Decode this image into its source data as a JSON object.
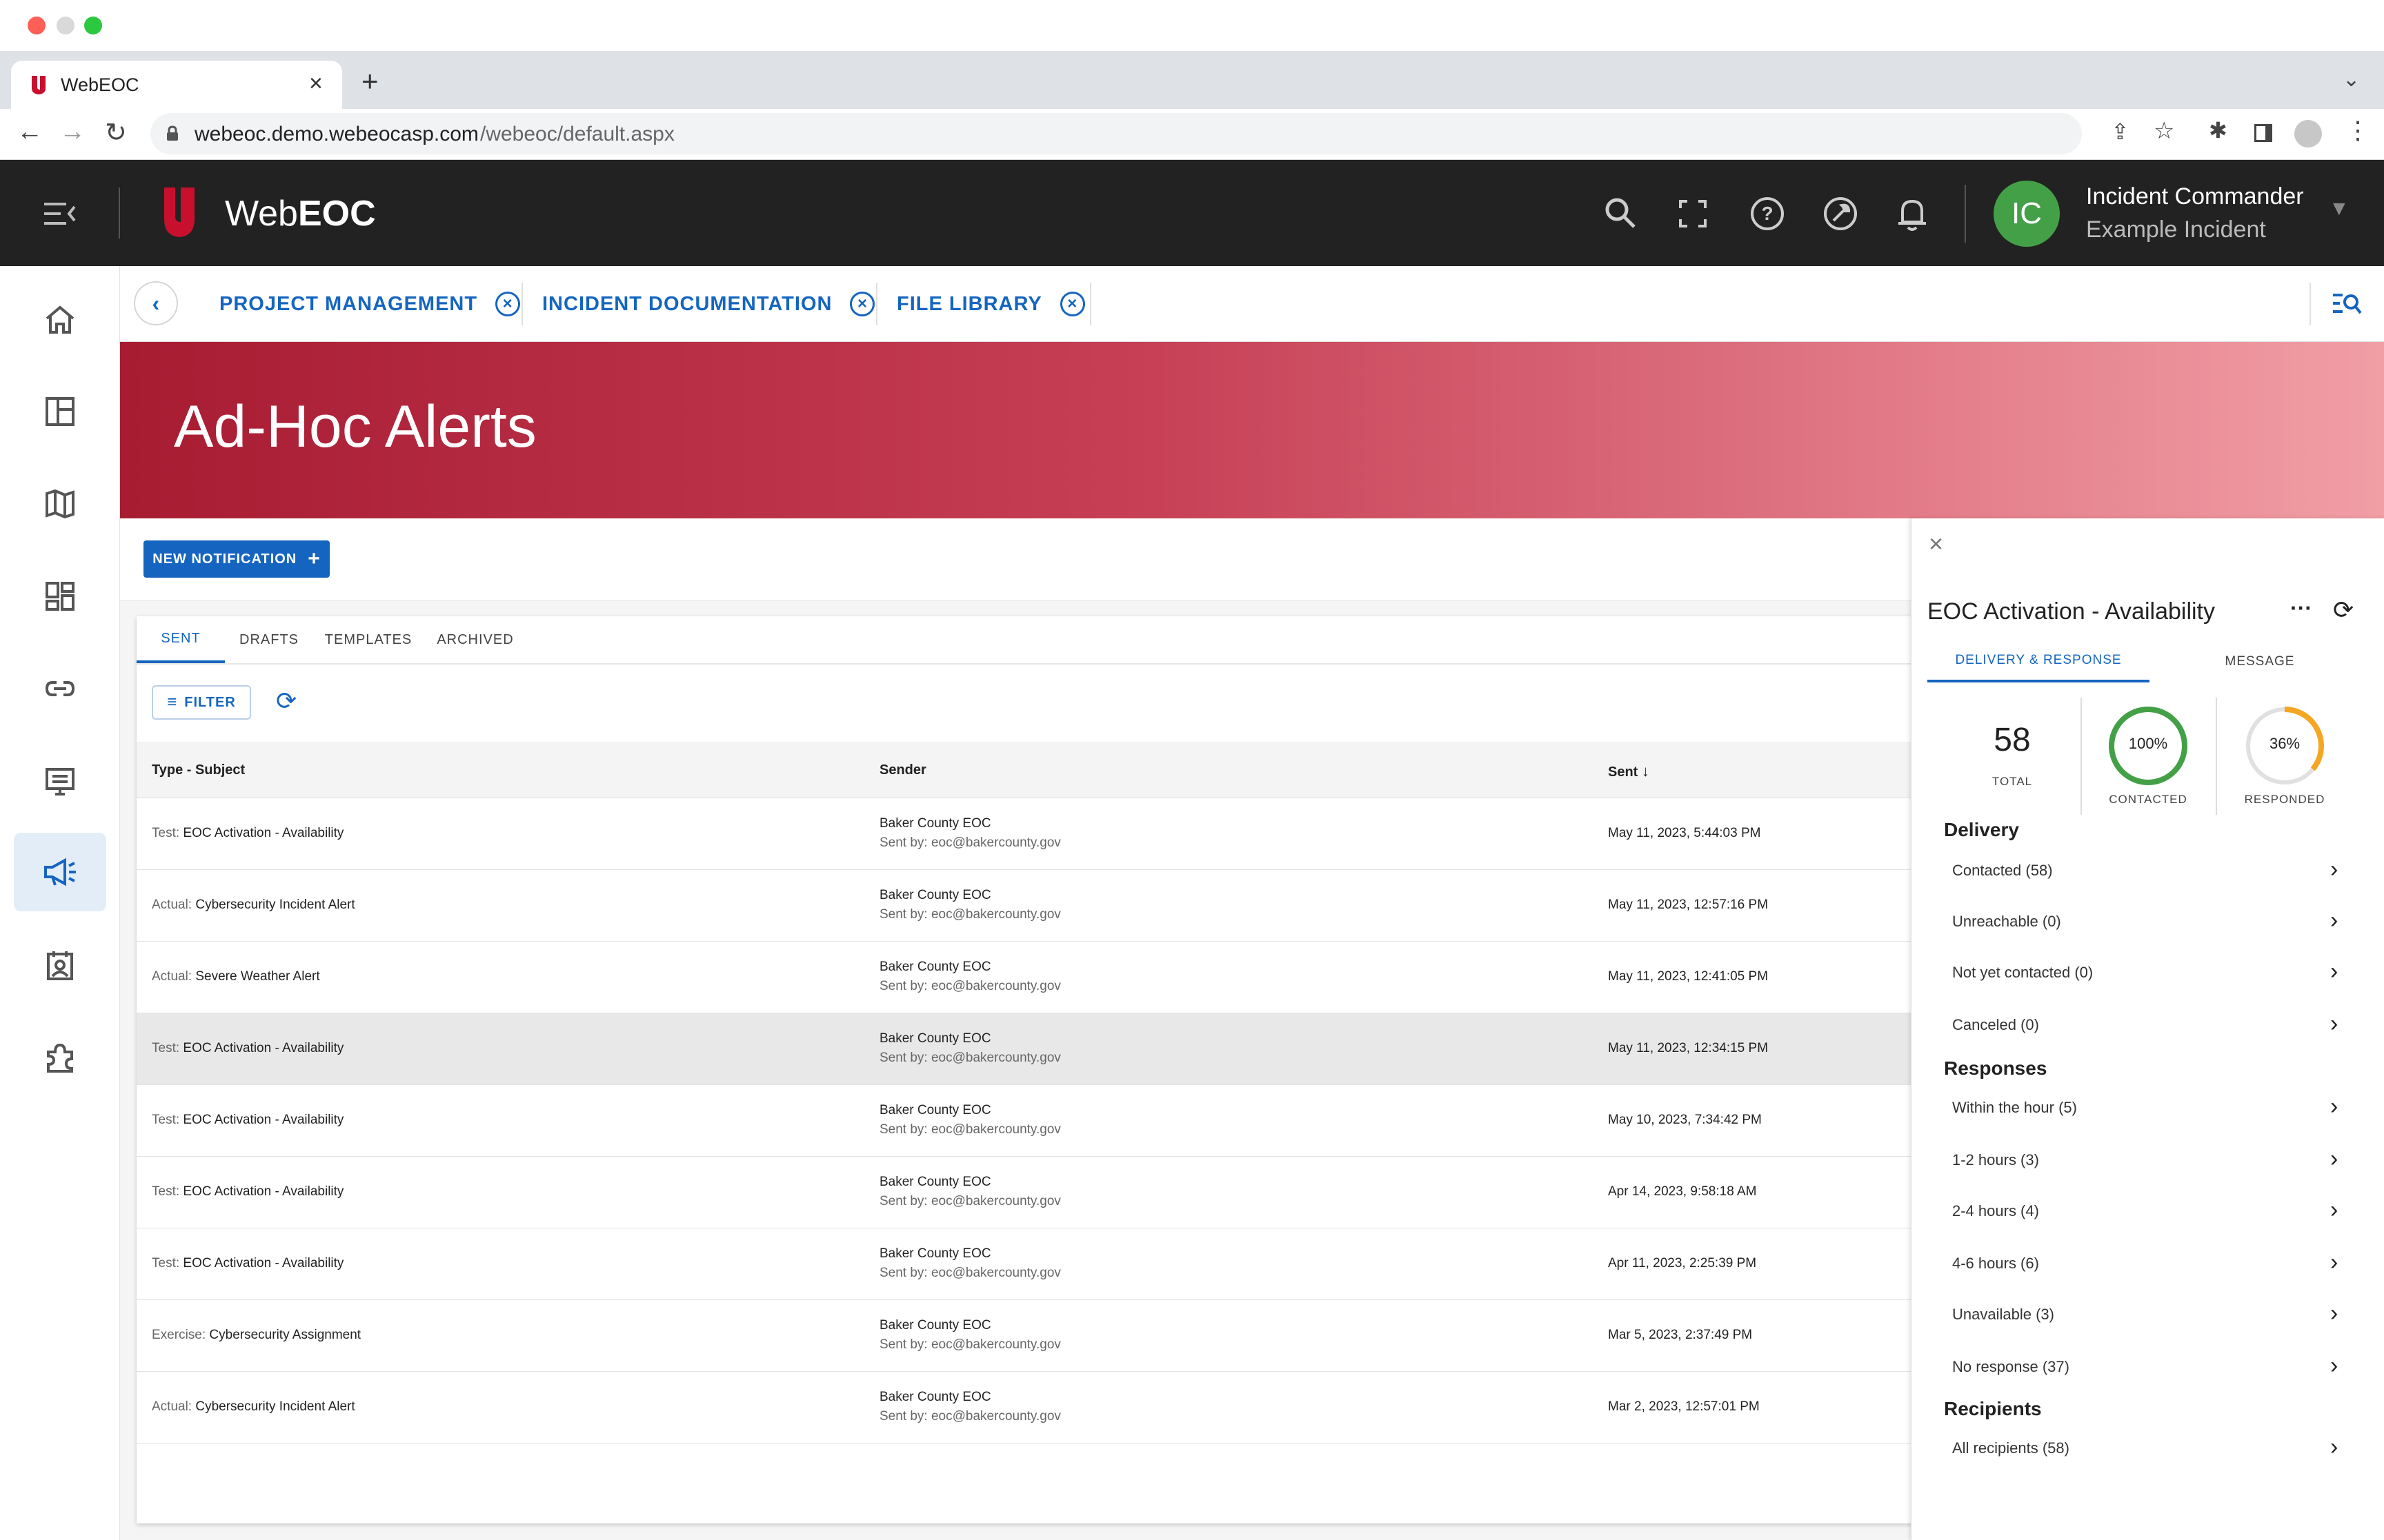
{
  "browser": {
    "tab_title": "WebEOC",
    "url_host": "webeoc.demo.webeocasp.com",
    "url_path": "/webeoc/default.aspx"
  },
  "app": {
    "brand_light": "Web",
    "brand_bold": "EOC",
    "user_initials": "IC",
    "user_role": "Incident Commander",
    "incident": "Example Incident",
    "accent": "#1565c0",
    "avatar_color": "#43a047"
  },
  "workspace_tabs": [
    {
      "label": "PROJECT MANAGEMENT"
    },
    {
      "label": "INCIDENT DOCUMENTATION"
    },
    {
      "label": "FILE LIBRARY"
    }
  ],
  "sidebar": {
    "items": [
      {
        "icon": "home-icon"
      },
      {
        "icon": "dashboard-layout-icon"
      },
      {
        "icon": "map-icon"
      },
      {
        "icon": "widgets-icon"
      },
      {
        "icon": "link-icon"
      },
      {
        "icon": "board-icon"
      },
      {
        "icon": "megaphone-icon",
        "active": true
      },
      {
        "icon": "contacts-icon"
      },
      {
        "icon": "plugin-icon"
      }
    ]
  },
  "banner": {
    "title": "Ad-Hoc Alerts"
  },
  "toolbar": {
    "new_notification": "NEW NOTIFICATION",
    "new_plus": "+"
  },
  "alerts": {
    "tabs": [
      "SENT",
      "DRAFTS",
      "TEMPLATES",
      "ARCHIVED"
    ],
    "filter_label": "FILTER",
    "columns": [
      "Type - Subject",
      "Sender",
      "Sent"
    ],
    "rows": [
      {
        "type": "Test:",
        "subject": "EOC Activation - Availability",
        "sender": "Baker County EOC",
        "sent_by": "Sent by: eoc@bakercounty.gov",
        "sent": "May 11, 2023, 5:44:03 PM"
      },
      {
        "type": "Actual:",
        "subject": "Cybersecurity Incident Alert",
        "sender": "Baker County EOC",
        "sent_by": "Sent by: eoc@bakercounty.gov",
        "sent": "May 11, 2023, 12:57:16 PM"
      },
      {
        "type": "Actual:",
        "subject": "Severe Weather Alert",
        "sender": "Baker County EOC",
        "sent_by": "Sent by: eoc@bakercounty.gov",
        "sent": "May 11, 2023, 12:41:05 PM"
      },
      {
        "type": "Test:",
        "subject": "EOC Activation - Availability",
        "sender": "Baker County EOC",
        "sent_by": "Sent by: eoc@bakercounty.gov",
        "sent": "May 11, 2023, 12:34:15 PM",
        "highlighted": true
      },
      {
        "type": "Test:",
        "subject": "EOC Activation - Availability",
        "sender": "Baker County EOC",
        "sent_by": "Sent by: eoc@bakercounty.gov",
        "sent": "May 10, 2023, 7:34:42 PM"
      },
      {
        "type": "Test:",
        "subject": "EOC Activation - Availability",
        "sender": "Baker County EOC",
        "sent_by": "Sent by: eoc@bakercounty.gov",
        "sent": "Apr 14, 2023, 9:58:18 AM"
      },
      {
        "type": "Test:",
        "subject": "EOC Activation - Availability",
        "sender": "Baker County EOC",
        "sent_by": "Sent by: eoc@bakercounty.gov",
        "sent": "Apr 11, 2023, 2:25:39 PM"
      },
      {
        "type": "Exercise:",
        "subject": "Cybersecurity Assignment",
        "sender": "Baker County EOC",
        "sent_by": "Sent by: eoc@bakercounty.gov",
        "sent": "Mar 5, 2023, 2:37:49 PM"
      },
      {
        "type": "Actual:",
        "subject": "Cybersecurity Incident Alert",
        "sender": "Baker County EOC",
        "sent_by": "Sent by: eoc@bakercounty.gov",
        "sent": "Mar 2, 2023, 12:57:01 PM"
      }
    ]
  },
  "detail": {
    "title": "EOC Activation - Availability",
    "tabs": [
      "DELIVERY & RESPONSE",
      "MESSAGE"
    ],
    "total": "58",
    "total_label": "TOTAL",
    "contacted_pct": "100%",
    "contacted_fraction": 1.0,
    "contacted_label": "CONTACTED",
    "responded_pct": "36%",
    "responded_fraction": 0.36,
    "responded_label": "RESPONDED",
    "ring_green": "#43a047",
    "ring_orange": "#f5a623",
    "delivery_heading": "Delivery",
    "delivery": [
      "Contacted (58)",
      "Unreachable (0)",
      "Not yet contacted (0)",
      "Canceled (0)"
    ],
    "responses_heading": "Responses",
    "responses": [
      "Within the hour (5)",
      "1-2  hours (3)",
      "2-4  hours (4)",
      "4-6  hours (6)",
      "Unavailable (3)",
      "No response (37)"
    ],
    "recipients_heading": "Recipients",
    "recipients": [
      "All recipients (58)"
    ]
  }
}
